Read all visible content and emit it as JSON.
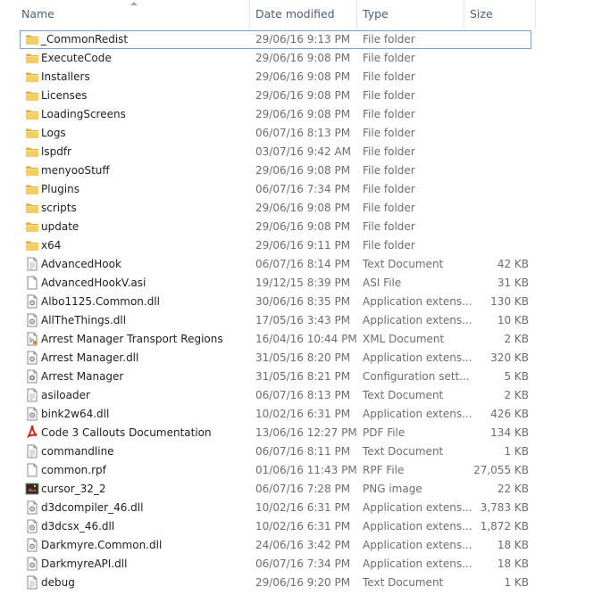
{
  "columns": {
    "name": "Name",
    "date": "Date modified",
    "type": "Type",
    "size": "Size"
  },
  "files": [
    {
      "name": "_CommonRedist",
      "date": "29/06/16 9:13 PM",
      "type": "File folder",
      "size": "",
      "icon": "folder-icon",
      "selected": true
    },
    {
      "name": "ExecuteCode",
      "date": "29/06/16 9:08 PM",
      "type": "File folder",
      "size": "",
      "icon": "folder-icon"
    },
    {
      "name": "Installers",
      "date": "29/06/16 9:08 PM",
      "type": "File folder",
      "size": "",
      "icon": "folder-icon"
    },
    {
      "name": "Licenses",
      "date": "29/06/16 9:08 PM",
      "type": "File folder",
      "size": "",
      "icon": "folder-icon"
    },
    {
      "name": "LoadingScreens",
      "date": "29/06/16 9:08 PM",
      "type": "File folder",
      "size": "",
      "icon": "folder-icon"
    },
    {
      "name": "Logs",
      "date": "06/07/16 8:13 PM",
      "type": "File folder",
      "size": "",
      "icon": "folder-icon"
    },
    {
      "name": "lspdfr",
      "date": "03/07/16 9:42 AM",
      "type": "File folder",
      "size": "",
      "icon": "folder-icon"
    },
    {
      "name": "menyooStuff",
      "date": "29/06/16 9:08 PM",
      "type": "File folder",
      "size": "",
      "icon": "folder-icon"
    },
    {
      "name": "Plugins",
      "date": "06/07/16 7:34 PM",
      "type": "File folder",
      "size": "",
      "icon": "folder-icon"
    },
    {
      "name": "scripts",
      "date": "29/06/16 9:08 PM",
      "type": "File folder",
      "size": "",
      "icon": "folder-icon"
    },
    {
      "name": "update",
      "date": "29/06/16 9:08 PM",
      "type": "File folder",
      "size": "",
      "icon": "folder-icon"
    },
    {
      "name": "x64",
      "date": "29/06/16 9:11 PM",
      "type": "File folder",
      "size": "",
      "icon": "folder-icon"
    },
    {
      "name": "AdvancedHook",
      "date": "06/07/16 8:14 PM",
      "type": "Text Document",
      "size": "42 KB",
      "icon": "text-file-icon"
    },
    {
      "name": "AdvancedHookV.asi",
      "date": "19/12/15 8:39 PM",
      "type": "ASI File",
      "size": "31 KB",
      "icon": "blank-file-icon"
    },
    {
      "name": "Albo1125.Common.dll",
      "date": "30/06/16 8:35 PM",
      "type": "Application extens...",
      "size": "130 KB",
      "icon": "dll-file-icon"
    },
    {
      "name": "AllTheThings.dll",
      "date": "17/05/16 3:43 PM",
      "type": "Application extens...",
      "size": "10 KB",
      "icon": "dll-file-icon"
    },
    {
      "name": "Arrest Manager Transport Regions",
      "date": "16/04/16 10:44 PM",
      "type": "XML Document",
      "size": "2 KB",
      "icon": "xml-file-icon"
    },
    {
      "name": "Arrest Manager.dll",
      "date": "31/05/16 8:20 PM",
      "type": "Application extens...",
      "size": "320 KB",
      "icon": "dll-file-icon"
    },
    {
      "name": "Arrest Manager",
      "date": "31/05/16 8:21 PM",
      "type": "Configuration sett...",
      "size": "5 KB",
      "icon": "config-file-icon"
    },
    {
      "name": "asiloader",
      "date": "06/07/16 8:13 PM",
      "type": "Text Document",
      "size": "2 KB",
      "icon": "text-file-icon"
    },
    {
      "name": "bink2w64.dll",
      "date": "10/02/16 6:31 PM",
      "type": "Application extens...",
      "size": "426 KB",
      "icon": "dll-file-icon"
    },
    {
      "name": "Code 3 Callouts Documentation",
      "date": "13/06/16 12:27 PM",
      "type": "PDF File",
      "size": "134 KB",
      "icon": "pdf-file-icon"
    },
    {
      "name": "commandline",
      "date": "06/07/16 8:11 PM",
      "type": "Text Document",
      "size": "1 KB",
      "icon": "text-file-icon"
    },
    {
      "name": "common.rpf",
      "date": "01/06/16 11:43 PM",
      "type": "RPF File",
      "size": "27,055 KB",
      "icon": "blank-file-icon"
    },
    {
      "name": "cursor_32_2",
      "date": "06/07/16 7:28 PM",
      "type": "PNG image",
      "size": "22 KB",
      "icon": "png-image-icon"
    },
    {
      "name": "d3dcompiler_46.dll",
      "date": "10/02/16 6:31 PM",
      "type": "Application extens...",
      "size": "3,783 KB",
      "icon": "dll-file-icon"
    },
    {
      "name": "d3dcsx_46.dll",
      "date": "10/02/16 6:31 PM",
      "type": "Application extens...",
      "size": "1,872 KB",
      "icon": "dll-file-icon"
    },
    {
      "name": "Darkmyre.Common.dll",
      "date": "24/06/16 3:42 PM",
      "type": "Application extens...",
      "size": "18 KB",
      "icon": "dll-file-icon"
    },
    {
      "name": "DarkmyreAPI.dll",
      "date": "06/07/16 7:34 PM",
      "type": "Application extens...",
      "size": "18 KB",
      "icon": "dll-file-icon"
    },
    {
      "name": "debug",
      "date": "29/06/16 9:20 PM",
      "type": "Text Document",
      "size": "1 KB",
      "icon": "text-file-icon"
    }
  ]
}
